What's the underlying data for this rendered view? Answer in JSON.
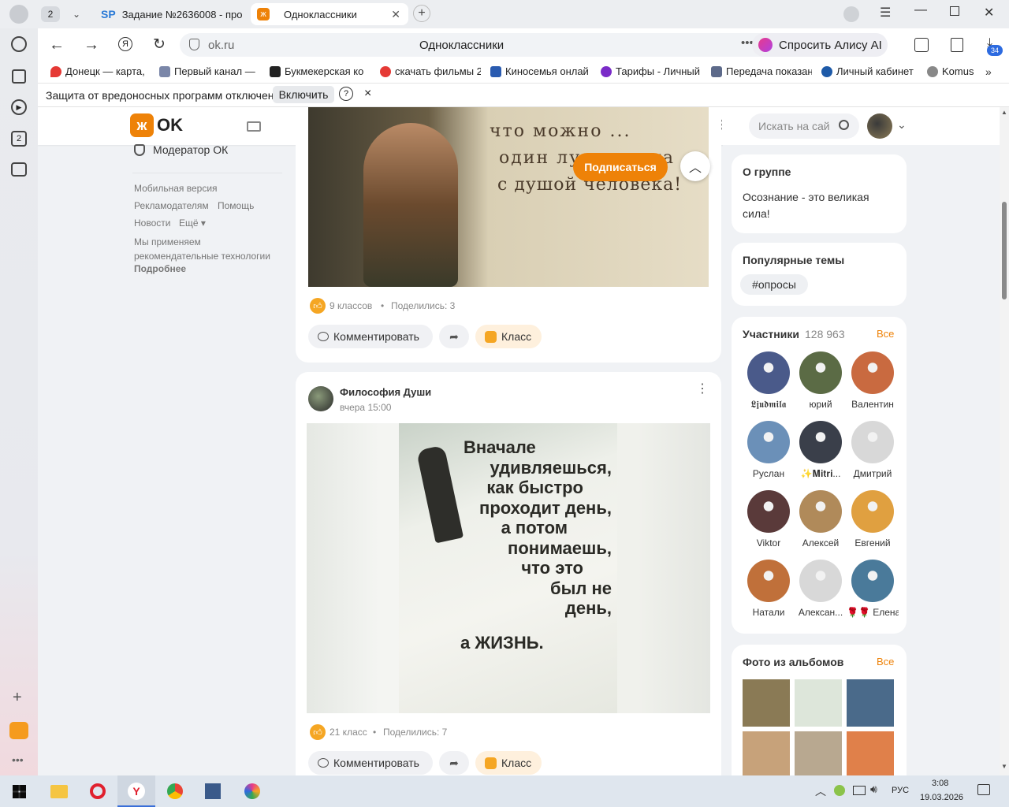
{
  "browser": {
    "tab_count": "2",
    "tabs": [
      {
        "label": "Задание №2636008 - про"
      },
      {
        "label": "Одноклассники"
      }
    ],
    "url": "ok.ru",
    "page_title": "Одноклассники",
    "alice_label": "Спросить Алису AI",
    "downloads_badge": "34"
  },
  "bookmarks": [
    {
      "label": "Донецк — карта, "
    },
    {
      "label": "Первый канал — "
    },
    {
      "label": "Букмекерская ко"
    },
    {
      "label": "скачать фильмы 2"
    },
    {
      "label": "Киносемья онлай"
    },
    {
      "label": "Тарифы - Личный"
    },
    {
      "label": "Передача показан"
    },
    {
      "label": "Личный кабинет"
    },
    {
      "label": "Komus"
    }
  ],
  "infobar": {
    "text": "Защита от вредоносных программ отключена",
    "button": "Включить",
    "help": "?",
    "close": "×"
  },
  "ok_header": {
    "logo_text": "OK",
    "search_placeholder": "Искать на сай"
  },
  "left_menu": {
    "moderator": "Модератор ОК",
    "links": [
      "Мобильная версия",
      "Рекламодателям",
      "Помощь",
      "Новости",
      "Ещё"
    ],
    "rec_text": "Мы применяем рекомендательные технологии",
    "more": "Подробнее"
  },
  "post1": {
    "image_text": [
      "что можно ...",
      "один луч солнца",
      "с душой человека!"
    ],
    "subscribe": "Подписаться",
    "likes": "9 классов",
    "shares": "Поделились: 3",
    "comment": "Комментировать",
    "klass": "Класс"
  },
  "post2": {
    "author": "Философия Души",
    "time": "вчера 15:00",
    "image_lines": [
      "Вначале",
      "удивляешься,",
      "как быстро",
      "проходит день,",
      "а потом",
      "понимаешь,",
      "что это",
      "был не",
      "день,",
      "а ЖИЗНЬ."
    ],
    "likes": "21 класс",
    "shares": "Поделились: 7",
    "comment": "Комментировать",
    "klass": "Класс"
  },
  "about": {
    "title": "О группе",
    "text": "Осознание - это великая сила!"
  },
  "topics": {
    "title": "Популярные темы",
    "tag": "#опросы"
  },
  "members": {
    "title": "Участники",
    "count": "128 963",
    "all": "Все",
    "list": [
      {
        "name": "𝕷𝖏𝖚𝖉𝖒𝖎𝖑𝖆",
        "color": "#4a5a8a"
      },
      {
        "name": "юрий",
        "color": "#5b6b45"
      },
      {
        "name": "Валентин",
        "color": "#c96a40"
      },
      {
        "name": "Руслан",
        "color": "#6b90b8"
      },
      {
        "name": "✨𝐌𝐢𝐭𝐫𝐢...",
        "color": "#3a3f4a"
      },
      {
        "name": "Дмитрий",
        "color": "#d8d8d8"
      },
      {
        "name": "Viktor",
        "color": "#5a3a3a"
      },
      {
        "name": "Алексей",
        "color": "#b08a5a"
      },
      {
        "name": "Евгений",
        "color": "#e0a040"
      },
      {
        "name": "Натали",
        "color": "#c0703a"
      },
      {
        "name": "Алексан...",
        "color": "#d8d8d8"
      },
      {
        "name": "🌹🌹 Елена",
        "color": "#4a7a9a"
      }
    ]
  },
  "photos": {
    "title": "Фото из альбомов",
    "all": "Все",
    "colors": [
      "#8a7a55",
      "#dde6da",
      "#4a6a8a",
      "#c7a27a",
      "#b8a890",
      "#e0804a"
    ]
  },
  "taskbar": {
    "lang": "РУС",
    "time": "3:08",
    "date": "19.03.2026"
  }
}
